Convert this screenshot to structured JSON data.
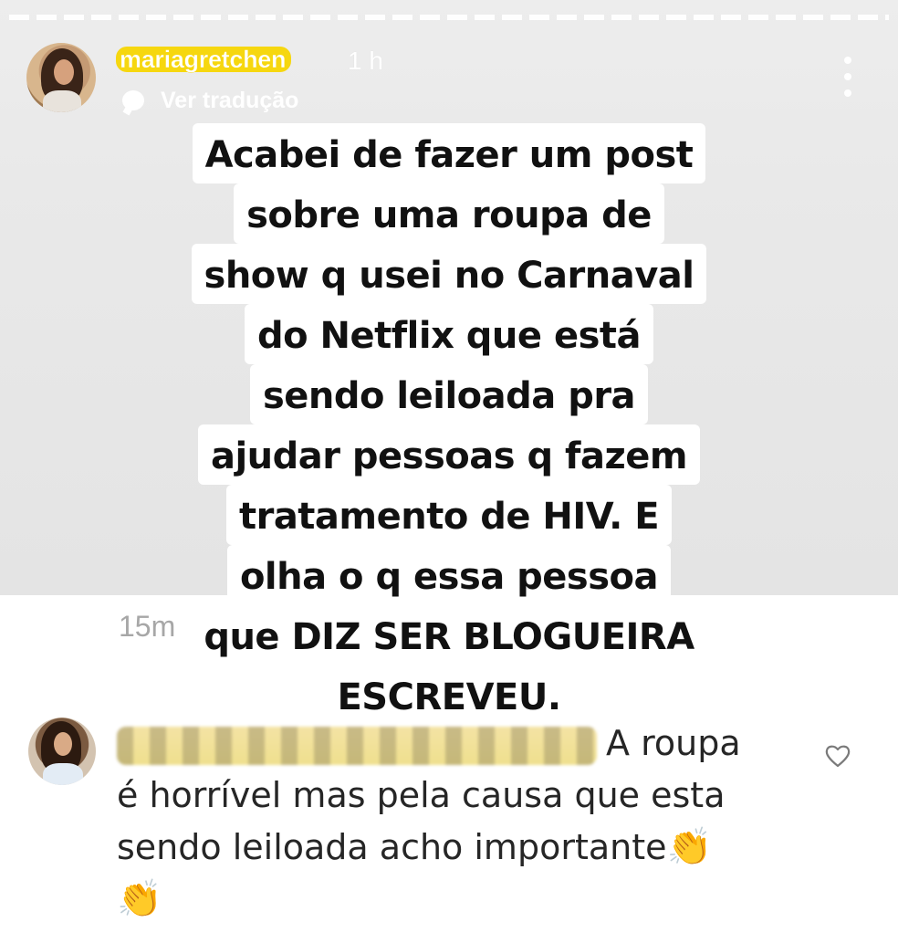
{
  "story": {
    "username": "mariagretchen",
    "timestamp": "1 h",
    "translate_label": "Ver tradução",
    "caption_lines": [
      "Acabei de fazer um post",
      "sobre uma roupa de",
      "show q usei no Carnaval",
      "do Netflix que está",
      "sendo leiloada pra",
      "ajudar pessoas q fazem",
      "tratamento de HIV. E",
      "olha o q essa pessoa",
      "que DIZ SER BLOGUEIRA",
      "ESCREVEU."
    ]
  },
  "comment": {
    "time": "15m",
    "text_line1": "A roupa",
    "text_line2": "é horrível mas pela causa que esta",
    "text_line3": "sendo leiloada acho importante",
    "emoji": "👏"
  },
  "icons": {
    "more": "more-vertical-icon",
    "translate": "speech-bubble-icon",
    "like": "heart-icon",
    "clap": "clapping-hands-icon"
  },
  "colors": {
    "username_highlight": "#f6d70f",
    "caption_background": "#ffffff",
    "caption_text": "#111111",
    "top_background": "#e8e8e8"
  }
}
